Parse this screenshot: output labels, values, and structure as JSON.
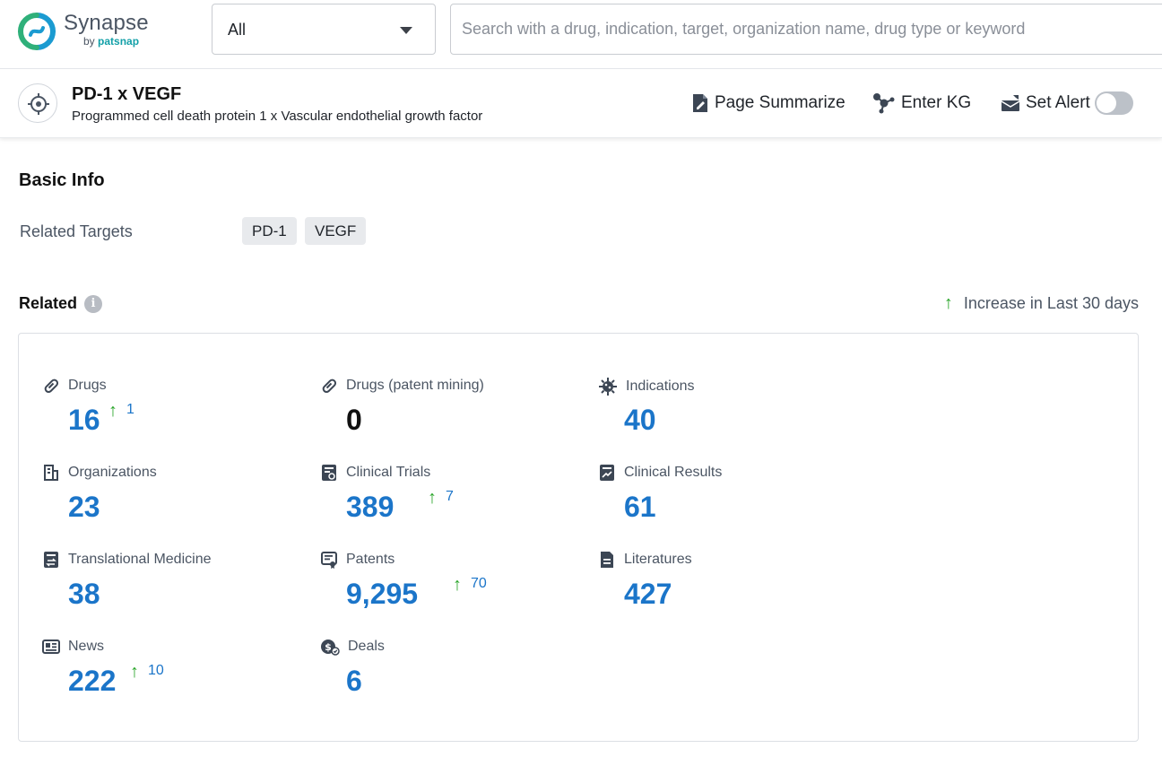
{
  "brand": {
    "name": "Synapse",
    "by": "by",
    "sub": "patsnap"
  },
  "search": {
    "scope": "All",
    "placeholder": "Search with a drug, indication, target, organization name, drug type or keyword"
  },
  "entity": {
    "title": "PD-1 x VEGF",
    "subtitle": "Programmed cell death protein 1 x Vascular endothelial growth factor",
    "actions": {
      "summarize": "Page Summarize",
      "kg": "Enter KG",
      "alert": "Set Alert"
    },
    "alert_enabled": false
  },
  "basic_info": {
    "title": "Basic Info",
    "related_targets_label": "Related Targets",
    "targets": [
      "PD-1",
      "VEGF"
    ]
  },
  "related": {
    "title": "Related",
    "legend": "Increase in Last 30 days",
    "stats": [
      {
        "label": "Drugs",
        "value": "16",
        "increase": "1",
        "icon": "pill-icon"
      },
      {
        "label": "Drugs (patent mining)",
        "value": "0",
        "increase": "",
        "icon": "pill-icon"
      },
      {
        "label": "Indications",
        "value": "40",
        "increase": "",
        "icon": "virus-icon"
      },
      {
        "label": "Organizations",
        "value": "23",
        "increase": "",
        "icon": "building-icon"
      },
      {
        "label": "Clinical Trials",
        "value": "389",
        "increase": "7",
        "icon": "trial-doc-icon"
      },
      {
        "label": "Clinical Results",
        "value": "61",
        "increase": "",
        "icon": "chart-doc-icon"
      },
      {
        "label": "Translational Medicine",
        "value": "38",
        "increase": "",
        "icon": "transfer-doc-icon"
      },
      {
        "label": "Patents",
        "value": "9,295",
        "increase": "70",
        "icon": "patent-icon"
      },
      {
        "label": "Literatures",
        "value": "427",
        "increase": "",
        "icon": "document-icon"
      },
      {
        "label": "News",
        "value": "222",
        "increase": "10",
        "icon": "newspaper-icon"
      },
      {
        "label": "Deals",
        "value": "6",
        "increase": "",
        "icon": "deal-icon"
      }
    ]
  },
  "colors": {
    "accent": "#1b75c9",
    "increase": "#2aa52a",
    "text": "#1f2329",
    "muted": "#4b5563"
  }
}
